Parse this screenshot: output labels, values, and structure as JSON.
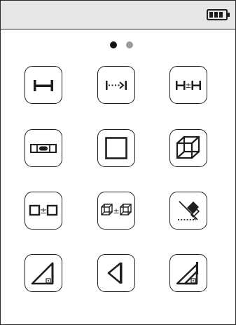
{
  "status_bar": {
    "battery_icon": "battery-icon",
    "battery_level": 0.75
  },
  "pager": {
    "pages": 2,
    "current_page": 1,
    "active_color": "#111111",
    "inactive_color": "#9a9a9a"
  },
  "menu": {
    "rows": [
      [
        {
          "icon": "single-distance-icon"
        },
        {
          "icon": "continuous-distance-icon"
        },
        {
          "icon": "add-subtract-distance-icon"
        }
      ],
      [
        {
          "icon": "level-icon"
        },
        {
          "icon": "area-icon"
        },
        {
          "icon": "volume-icon"
        }
      ],
      [
        {
          "icon": "add-subtract-area-icon"
        },
        {
          "icon": "add-subtract-volume-icon"
        },
        {
          "icon": "wall-area-icon"
        }
      ],
      [
        {
          "icon": "pythagoras-two-point-icon"
        },
        {
          "icon": "pythagoras-three-point-icon"
        },
        {
          "icon": "partial-height-icon"
        }
      ]
    ]
  },
  "colors": {
    "status_bar_bg": "#e7e7e8",
    "stroke": "#1e1e1e"
  }
}
